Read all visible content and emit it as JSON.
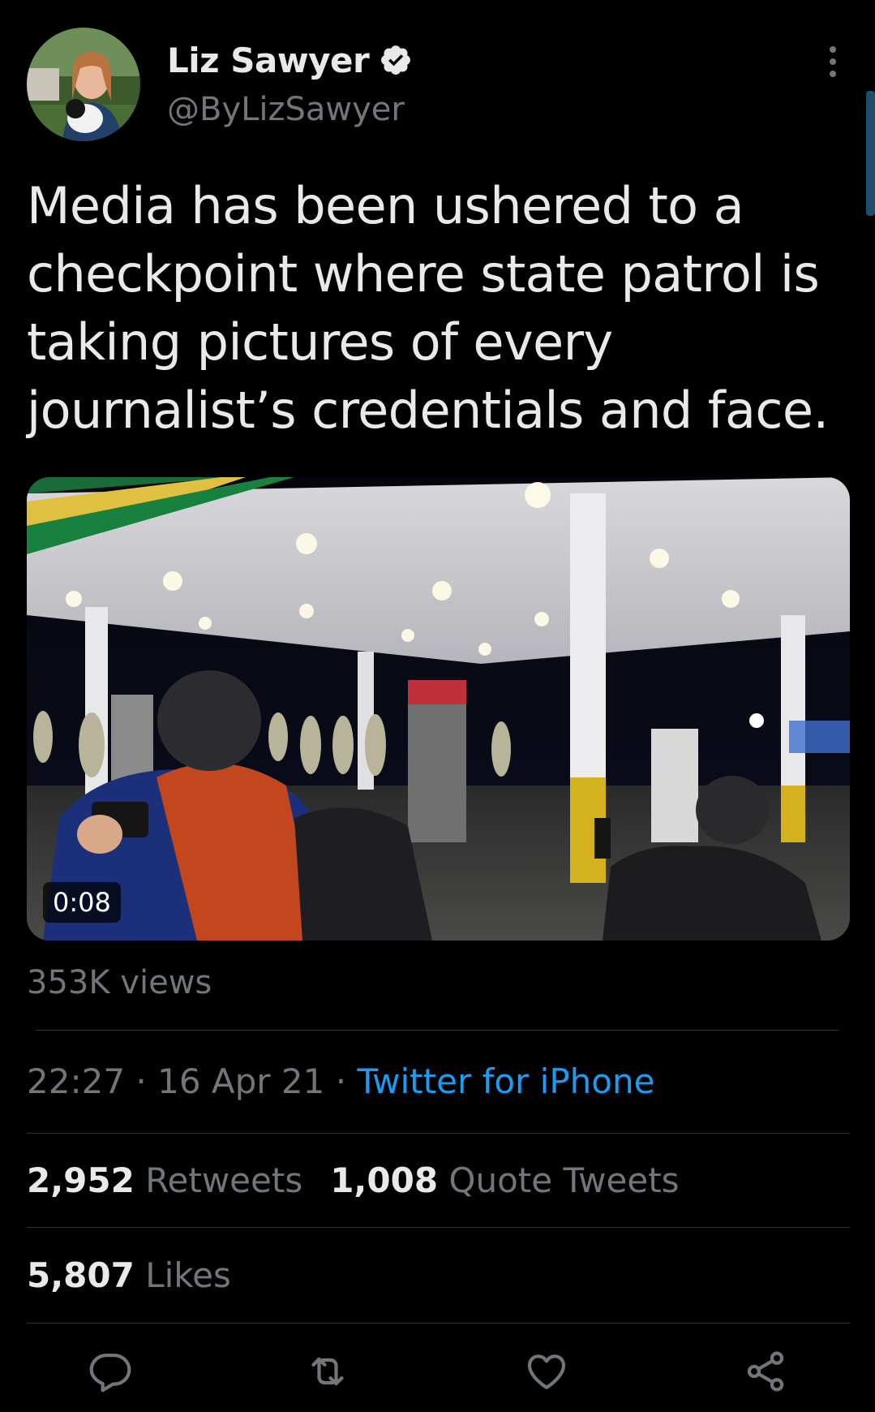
{
  "author": {
    "display_name": "Liz Sawyer",
    "handle": "@ByLizSawyer",
    "verified": true,
    "avatar_icon": "profile-photo"
  },
  "tweet": {
    "text": "Media has been ushered to a checkpoint where state patrol is taking pictures of every journalist’s credentials and face."
  },
  "media": {
    "type": "video",
    "duration": "0:08"
  },
  "views": "353K views",
  "meta": {
    "time": "22:27",
    "separator": "·",
    "date": "16 Apr 21",
    "source": "Twitter for iPhone"
  },
  "stats": {
    "retweets_count": "2,952",
    "retweets_label": "Retweets",
    "quotes_count": "1,008",
    "quotes_label": "Quote Tweets",
    "likes_count": "5,807",
    "likes_label": "Likes"
  },
  "actions": {
    "icons": [
      "reply-icon",
      "retweet-icon",
      "like-icon",
      "share-icon"
    ]
  },
  "colors": {
    "background": "#000000",
    "text_primary": "#e7e9ea",
    "text_secondary": "#71767b",
    "accent": "#1d9bf0",
    "divider": "#2f3336"
  }
}
